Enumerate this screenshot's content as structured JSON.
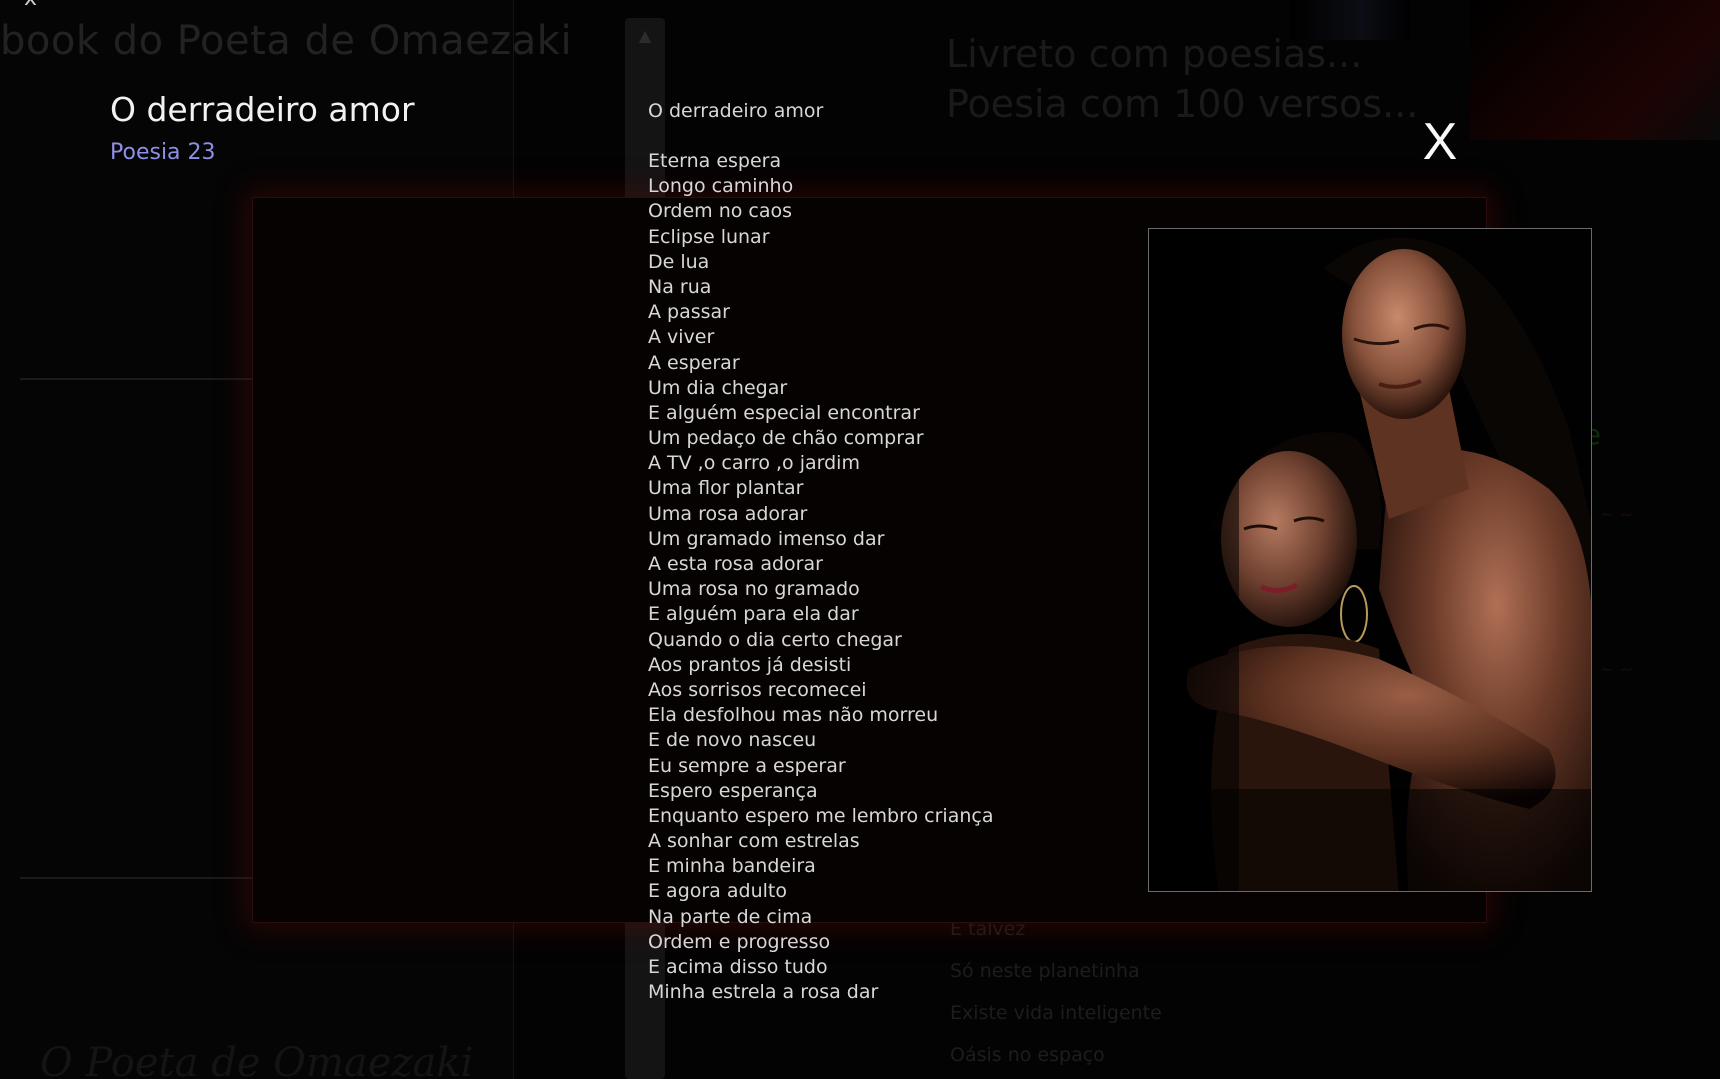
{
  "background": {
    "corner_close": "x",
    "site_title": "book do Poeta de Omaezaki",
    "headline_1": "Livreto com poesias...",
    "headline_2": "Poesia com 100 versos...",
    "green_fragment": "nte",
    "footer_title": "O Poeta de Omaezaki",
    "verse_lines": [
      "E talvez",
      "Só neste planetinha",
      "Existe vida inteligente",
      "Oásis no espaço"
    ]
  },
  "modal": {
    "title": "O derradeiro amor",
    "subtitle": "Poesia 23",
    "close_label": "X",
    "poem_title": "O derradeiro amor",
    "poem_lines": [
      "Eterna espera",
      "Longo caminho",
      "Ordem no caos",
      "Eclipse lunar",
      "De lua",
      "Na rua",
      "A passar",
      "A viver",
      "A esperar",
      "Um dia chegar",
      "E alguém especial encontrar",
      "Um pedaço de chão comprar",
      "A TV ,o carro ,o jardim",
      "Uma flor plantar",
      "Uma rosa adorar",
      "Um gramado imenso dar",
      "A esta rosa adorar",
      "Uma rosa no gramado",
      "E alguém para ela dar",
      "Quando o dia certo chegar",
      "Aos prantos já desisti",
      "Aos sorrisos recomecei",
      "Ela desfolhou mas não morreu",
      "E de novo nasceu",
      "Eu sempre a esperar",
      "Espero esperança",
      "Enquanto espero me lembro criança",
      "A sonhar com estrelas",
      "E minha bandeira",
      "E agora adulto",
      "Na parte de cima",
      "Ordem e progresso",
      "E acima disso tudo",
      "Minha estrela a rosa dar"
    ],
    "photo_icon": "couple-photo"
  },
  "colors": {
    "title": "#f2f2f2",
    "subtitle": "#8f8fe6",
    "poem_text": "#d7d7d7",
    "frame_glow": "#6e0a0a"
  }
}
